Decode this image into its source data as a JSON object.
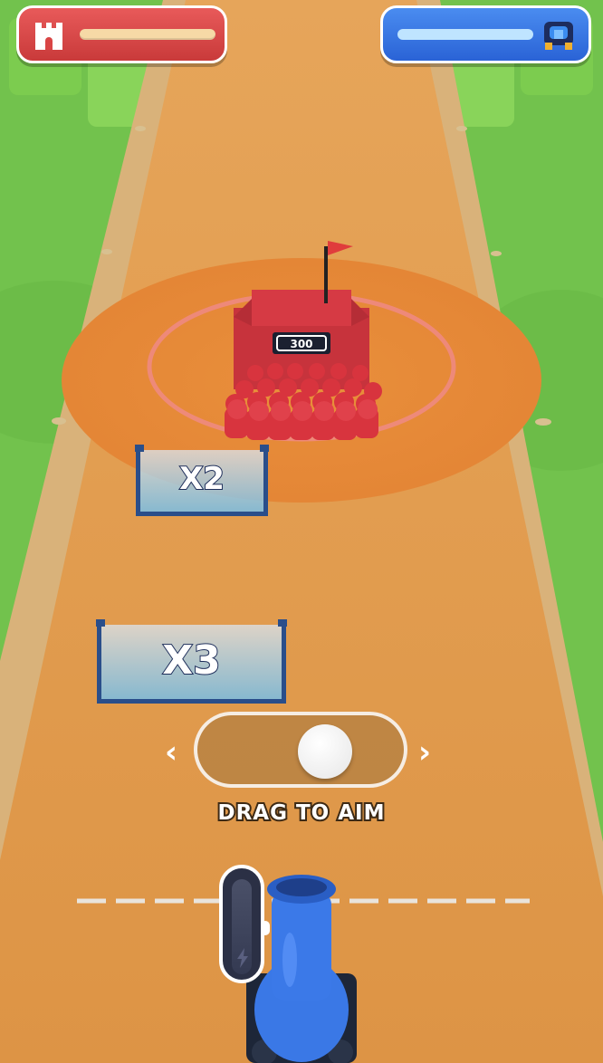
{
  "hud": {
    "enemy": {
      "icon": "castle-icon",
      "color": "#d94545",
      "health": 1.0
    },
    "player": {
      "icon": "blue-base-icon",
      "color": "#3473e4",
      "health": 1.0
    }
  },
  "enemy_base": {
    "count": "300",
    "flag_color": "#e03c3c"
  },
  "gates": [
    {
      "label": "X2"
    },
    {
      "label": "X3"
    }
  ],
  "aim_control": {
    "hint": "DRAG TO AIM",
    "left_arrow": "‹",
    "right_arrow": "›",
    "position": 0.68
  },
  "power_meter": {
    "icon": "lightning-icon",
    "level": 0.0
  },
  "colors": {
    "track": "#e39a48",
    "grass": "#6fbf4a",
    "player": "#3a78e6",
    "enemy": "#d63a3a"
  }
}
